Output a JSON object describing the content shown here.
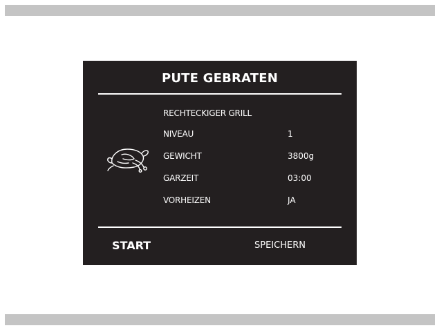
{
  "panel": {
    "title": "PUTE GEBRATEN",
    "program": "RECHTECKIGER GRILL",
    "params": [
      {
        "label": "NIVEAU",
        "value": "1"
      },
      {
        "label": "GEWICHT",
        "value": "3800g"
      },
      {
        "label": "GARZEIT",
        "value": "03:00"
      },
      {
        "label": "VORHEIZEN",
        "value": "JA"
      }
    ],
    "icon": "roast-poultry-icon",
    "start_label": "START",
    "save_label": "SPEICHERN"
  },
  "colors": {
    "panel_background": "#231f20",
    "text": "#ffffff",
    "bars": "#c4c4c4"
  }
}
